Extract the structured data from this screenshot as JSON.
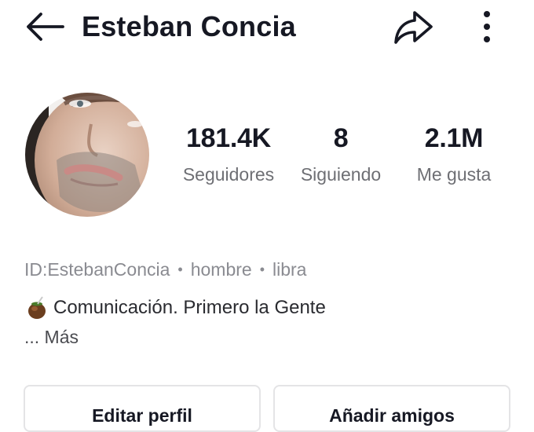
{
  "header": {
    "title": "Esteban Concia",
    "back_icon": "back-arrow-icon",
    "share_icon": "share-arrow-icon",
    "more_icon": "more-vertical-icon"
  },
  "profile": {
    "avatar": "profile-photo"
  },
  "stats": [
    {
      "value": "181.4K",
      "label": "Seguidores"
    },
    {
      "value": "8",
      "label": "Siguiendo"
    },
    {
      "value": "2.1M",
      "label": "Me gusta"
    }
  ],
  "meta": {
    "id": "ID:EstebanConcia",
    "gender": "hombre",
    "sign": "libra"
  },
  "bio": {
    "text": "Comunicación. Primero la Gente",
    "more": "... Más"
  },
  "actions": {
    "edit_profile": "Editar perfil",
    "add_friends": "Añadir amigos"
  },
  "colors": {
    "primary_text": "#161823",
    "secondary_text": "#6e6f74",
    "muted_text": "#8a8b91",
    "button_border": "#e4e4e6"
  }
}
